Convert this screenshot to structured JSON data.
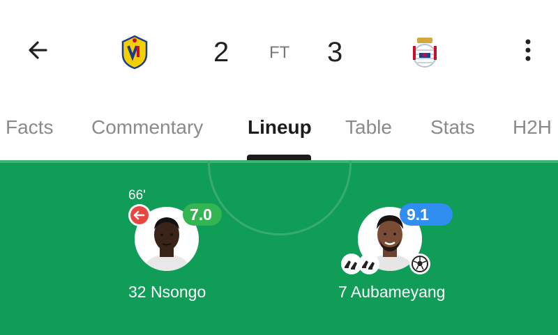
{
  "match": {
    "home_score": "2",
    "status": "FT",
    "away_score": "3"
  },
  "tabs": [
    {
      "label": "Facts"
    },
    {
      "label": "Commentary"
    },
    {
      "label": "Lineup"
    },
    {
      "label": "Table"
    },
    {
      "label": "Stats"
    },
    {
      "label": "H2H"
    }
  ],
  "players": [
    {
      "name": "32 Nsongo",
      "rating": "7.0",
      "sub_minute": "66'",
      "rating_color": "#33b551"
    },
    {
      "name": "7 Aubameyang",
      "rating": "9.1",
      "rating_star": "★",
      "rating_color": "#2f8ef0"
    }
  ],
  "colors": {
    "pitch": "#0f9d58",
    "active_tab": "#1c1c1c",
    "sub_off": "#e8473f"
  }
}
